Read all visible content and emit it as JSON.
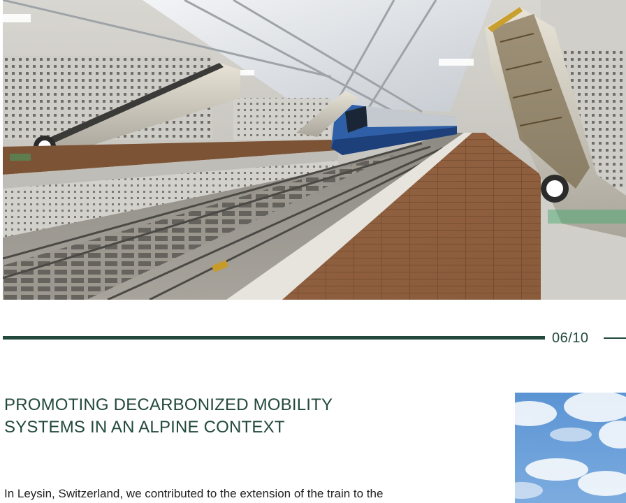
{
  "page": {
    "counter": "06/10",
    "progress": 0.6
  },
  "article": {
    "title_line1": "PROMOTING DECARBONIZED MOBILITY",
    "title_line2": "SYSTEMS IN AN ALPINE CONTEXT",
    "body": "In Leysin, Switzerland, we contributed to the extension of the train to the"
  },
  "colors": {
    "accent": "#22493b",
    "text": "#222222"
  }
}
